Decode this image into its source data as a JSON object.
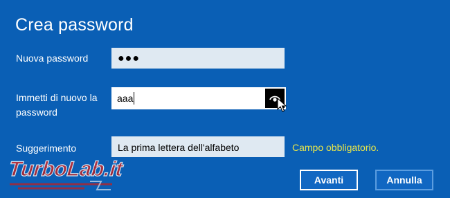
{
  "dialog": {
    "title": "Crea password"
  },
  "new_password": {
    "label": "Nuova password",
    "value_masked": "●●●"
  },
  "confirm_password": {
    "label_line1": "Immetti di nuovo la",
    "label_line2": "password",
    "value": "aaa"
  },
  "hint": {
    "label": "Suggerimento",
    "value": "La prima lettera dell'alfabeto",
    "message": "Campo obbligatorio."
  },
  "buttons": {
    "next": "Avanti",
    "cancel": "Annulla"
  },
  "watermark": {
    "text": "TurboLab.it"
  },
  "colors": {
    "background": "#0a5fb5",
    "warning": "#e8e64a",
    "field_dim": "#dfe9f2"
  }
}
